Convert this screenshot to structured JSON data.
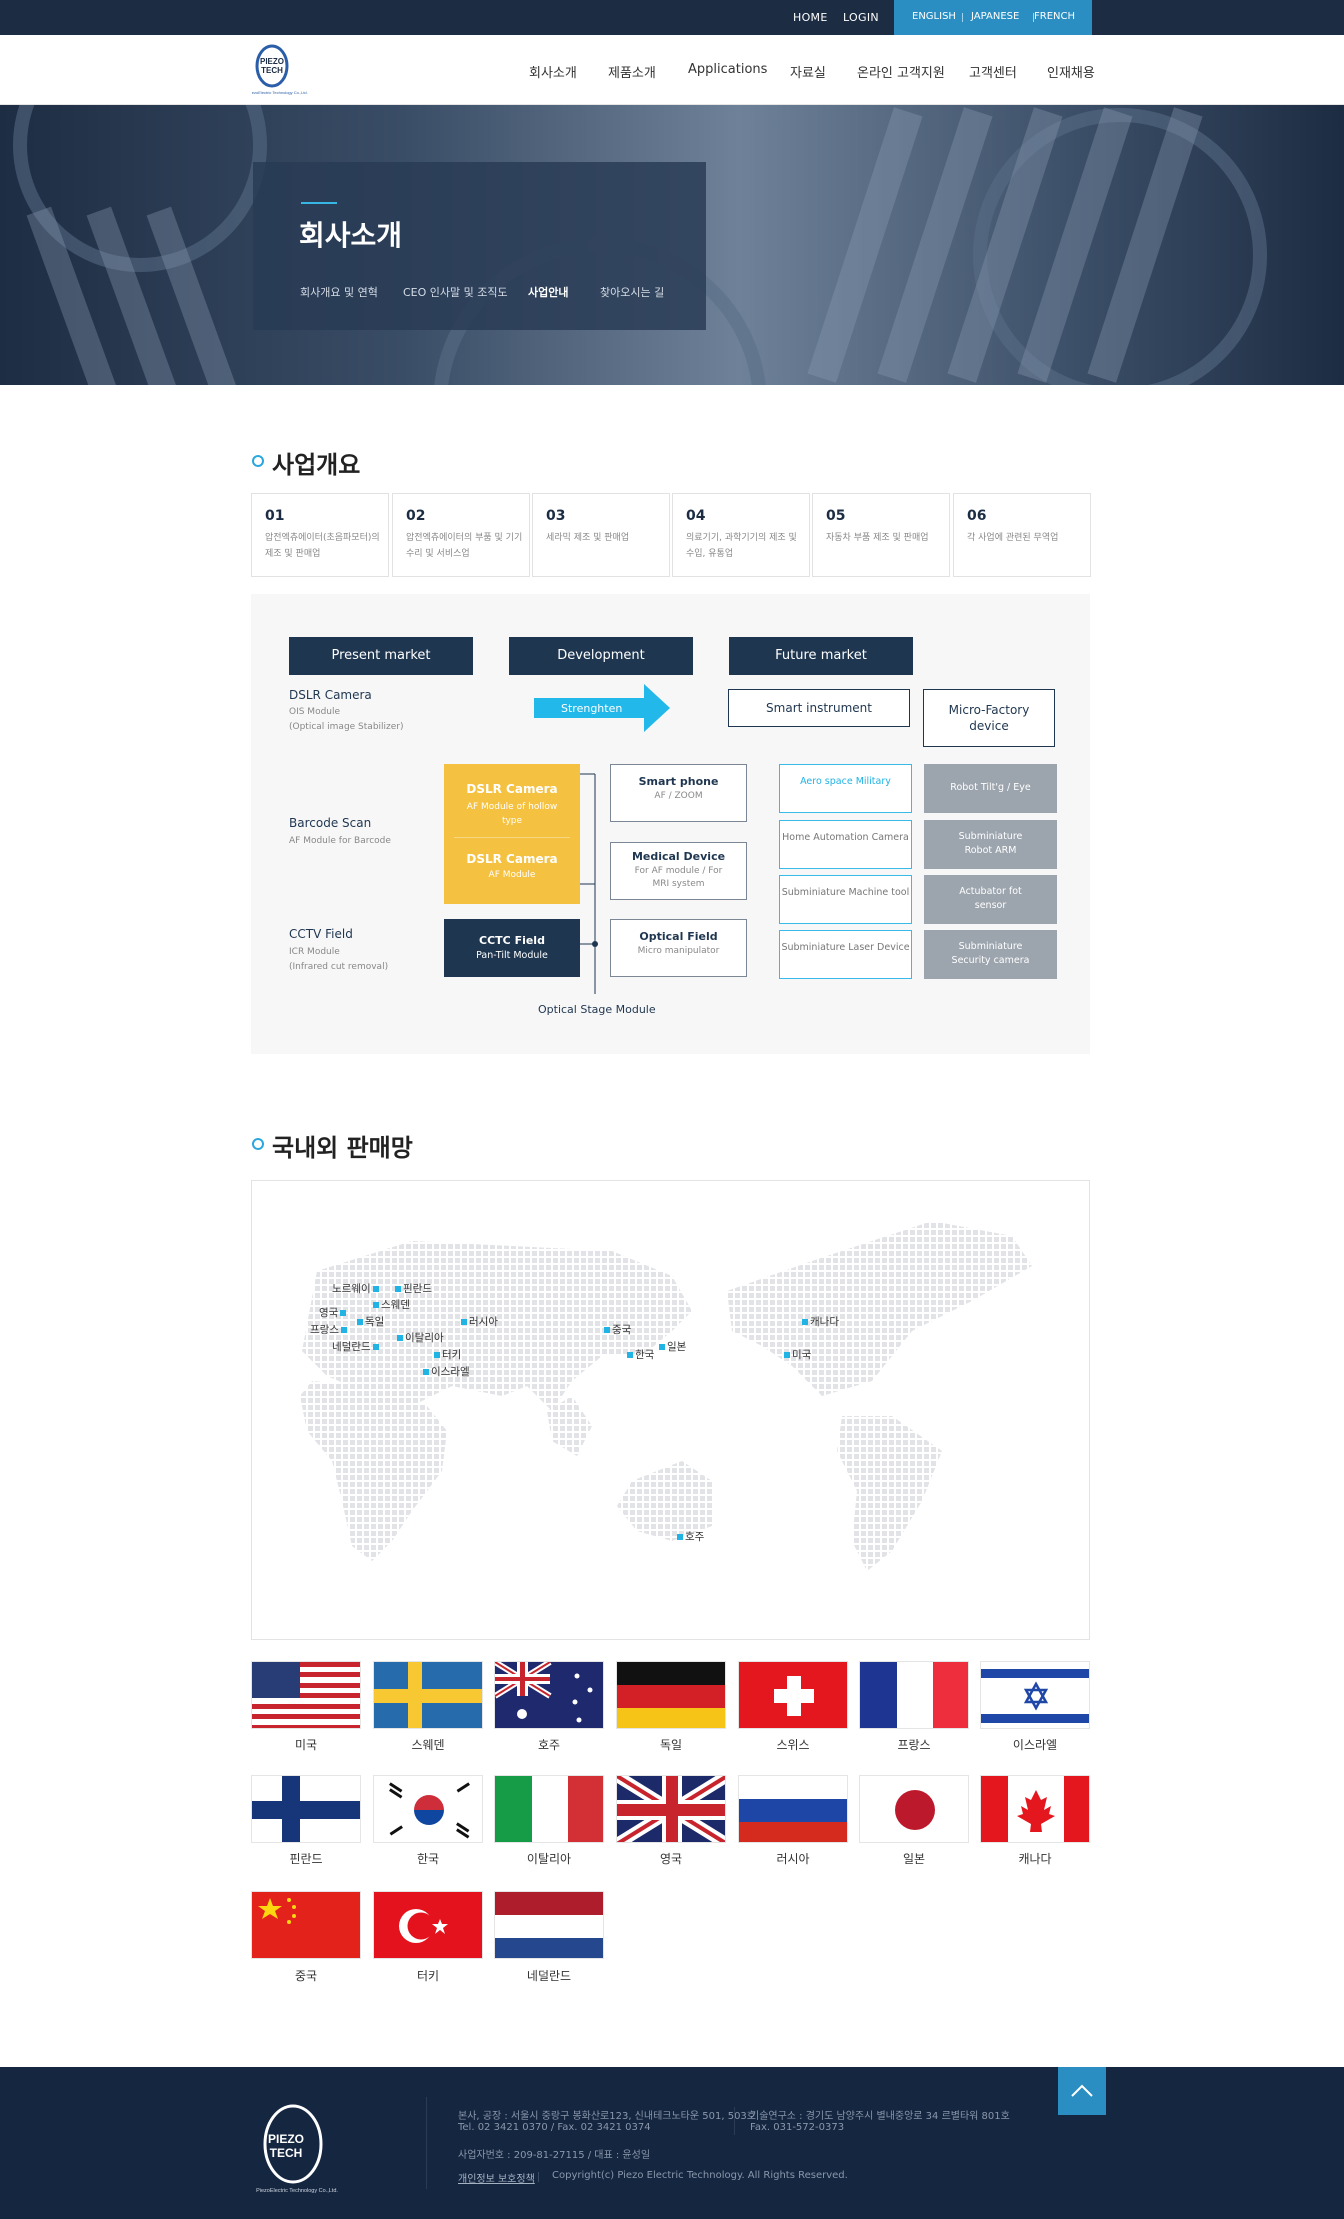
{
  "topbar": {
    "home": "HOME",
    "login": "LOGIN",
    "langs": [
      "ENGLISH",
      "JAPANESE",
      "FRENCH"
    ]
  },
  "logo": {
    "line1": "PIEZO",
    "line2": "TECH",
    "small": "PiezoElectric Technology Co.,Ltd."
  },
  "nav": [
    "회사소개",
    "제품소개",
    "Applications",
    "자료실",
    "온라인 고객지원",
    "고객센터",
    "인재채용"
  ],
  "hero": {
    "title": "회사소개",
    "subnav": [
      "회사개요 및 연혁",
      "CEO 인사말 및 조직도",
      "사업안내",
      "찾아오시는 길"
    ],
    "active": "사업안내"
  },
  "business": {
    "title": "사업개요",
    "cards": [
      {
        "num": "01",
        "desc": "압전엑츄에이터(초음파모터)의 제조 및 판매업"
      },
      {
        "num": "02",
        "desc": "압전엑츄에이터의 부품 및 기기수리 및 서비스업"
      },
      {
        "num": "03",
        "desc": "세라믹 제조 및 판매업"
      },
      {
        "num": "04",
        "desc": "의료기기, 과학기기의 제조 및 수입, 유통업"
      },
      {
        "num": "05",
        "desc": "자동차 부품 제조 및 판매업"
      },
      {
        "num": "06",
        "desc": "각 사업에 관련된 무역업"
      }
    ]
  },
  "diagram": {
    "present": "Present market",
    "development": "Development",
    "future": "Future market",
    "strengthen": "Strenghten",
    "smart_instrument": "Smart instrument",
    "micro_factory": "Micro-Factory device",
    "rows": [
      {
        "title": "DSLR Camera",
        "sub1": "OIS Module",
        "sub2": "(Optical image Stabilizer)"
      },
      {
        "title": "Barcode Scan",
        "sub1": "AF Module for Barcode",
        "sub2": ""
      },
      {
        "title": "CCTV Field",
        "sub1": "ICR Module",
        "sub2": "(Infrared cut removal)"
      }
    ],
    "dslr1": {
      "title": "DSLR Camera",
      "sub": "AF Module of hollow type"
    },
    "dslr2": {
      "title": "DSLR Camera",
      "sub": "AF Module"
    },
    "cctc": {
      "title": "CCTC Field",
      "sub": "Pan-Tilt Module"
    },
    "smartphone": {
      "title": "Smart phone",
      "sub": "AF / ZOOM"
    },
    "medical": {
      "title": "Medical Device",
      "sub": "For AF module / For MRI system"
    },
    "optical": {
      "title": "Optical Field",
      "sub": "Micro manipulator"
    },
    "stage": "Optical Stage Module",
    "future_cyan": [
      "Aero space Military",
      "Home Automation Camera",
      "Subminiature Machine tool",
      "Subminiature Laser Device"
    ],
    "future_gray": [
      "Robot Tilt'g / Eye",
      "Subminiature Robot ARM",
      "Actubator fot sensor",
      "Subminiature Security camera"
    ]
  },
  "network": {
    "title": "국내외 판매망",
    "markers": [
      "노르웨이",
      "핀란드",
      "스웨덴",
      "영국",
      "독일",
      "프랑스",
      "네덜란드",
      "이탈리아",
      "러시아",
      "터키",
      "이스라엘",
      "중국",
      "한국",
      "일본",
      "호주",
      "캐나다",
      "미국"
    ]
  },
  "flags": [
    "미국",
    "스웨덴",
    "호주",
    "독일",
    "스위스",
    "프랑스",
    "이스라엘",
    "핀란드",
    "한국",
    "이탈리아",
    "영국",
    "러시아",
    "일본",
    "캐나다",
    "중국",
    "터키",
    "네덜란드"
  ],
  "footer": {
    "addr1": "본사, 공장 : 서울시 중랑구 봉화산로123, 신내테크노타운 501, 503호",
    "tel1": "Tel. 02 3421 0370  /  Fax. 02 3421 0374",
    "addr2": "기술연구소 : 경기도 남양주시 별내중앙로 34 르별타워 801호",
    "fax2": "Fax. 031-572-0373",
    "biz": "사업자번호 : 209-81-27115  /  대표 : 윤성일",
    "privacy": "개인정보 보호정책",
    "copyright": "Copyright(c) Piezo Electric Technology. All Rights Reserved."
  },
  "colors": {
    "navy": "#1c2c43",
    "accent": "#2b8ec2",
    "cyan": "#22b3e5",
    "yellow": "#f4c141"
  }
}
